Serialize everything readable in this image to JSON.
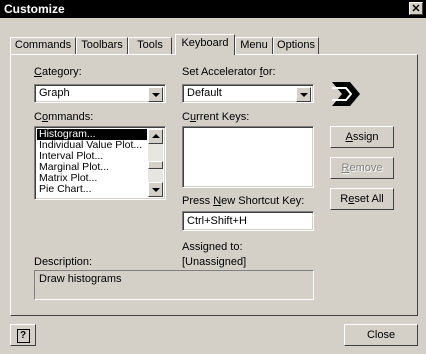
{
  "window": {
    "title": "Customize",
    "close_glyph": "✕"
  },
  "tabs": [
    {
      "label": "Commands",
      "active": false
    },
    {
      "label": "Toolbars",
      "active": false
    },
    {
      "label": "Tools",
      "active": false
    },
    {
      "label": "Keyboard",
      "active": true
    },
    {
      "label": "Menu",
      "active": false
    },
    {
      "label": "Options",
      "active": false
    }
  ],
  "category": {
    "label_pre": "",
    "label_ul": "C",
    "label_post": "ategory:",
    "value": "Graph"
  },
  "commands": {
    "label_pre": "C",
    "label_ul": "o",
    "label_post": "mmands:",
    "items": [
      "Histogram...",
      "Individual Value Plot...",
      "Interval Plot...",
      "Marginal Plot...",
      "Matrix Plot...",
      "Pie Chart..."
    ],
    "selected_index": 0
  },
  "accelerator": {
    "label_pre": "Set Accelerator ",
    "label_ul": "f",
    "label_post": "or:",
    "value": "Default"
  },
  "current_keys": {
    "label_pre": "C",
    "label_ul": "u",
    "label_post": "rrent Keys:"
  },
  "shortcut": {
    "label_pre": "Press ",
    "label_ul": "N",
    "label_post": "ew Shortcut Key:",
    "value": "Ctrl+Shift+H"
  },
  "assigned": {
    "label": "Assigned to:",
    "value": "[Unassigned]"
  },
  "description": {
    "label": "Description:",
    "value": "Draw histograms"
  },
  "buttons": {
    "assign": {
      "pre": "",
      "ul": "A",
      "post": "ssign",
      "enabled": true
    },
    "remove": {
      "pre": "",
      "ul": "R",
      "post": "emove",
      "enabled": false
    },
    "reset": {
      "pre": "R",
      "ul": "e",
      "post": "set All",
      "enabled": true
    },
    "help": "?",
    "close": "Close"
  },
  "icons": {
    "accelerator": "accelerator-icon",
    "help": "help-icon",
    "close": "close-icon"
  }
}
